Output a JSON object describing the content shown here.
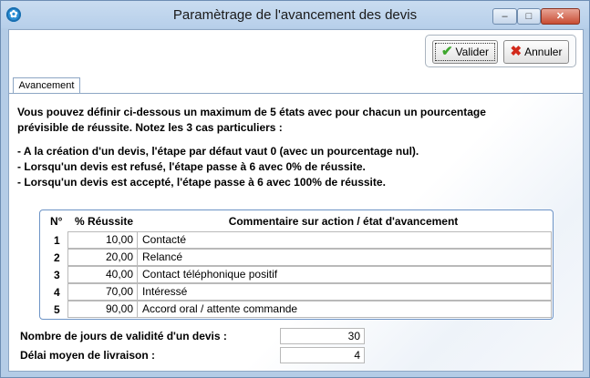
{
  "window": {
    "title": "Paramètrage de l'avancement des devis",
    "controls": {
      "minimize": "–",
      "maximize": "□",
      "close": "✕"
    }
  },
  "toolbar": {
    "validate_label": "Valider",
    "cancel_label": "Annuler"
  },
  "tabs": [
    {
      "label": "Avancement",
      "active": true
    }
  ],
  "intro": {
    "line1": "Vous pouvez définir ci-dessous un maximum de 5 états avec pour chacun un pourcentage",
    "line2": "prévisible de réussite. Notez les 3 cas particuliers :",
    "case1": "- A la création d'un devis, l'étape par défaut vaut 0 (avec un pourcentage nul).",
    "case2": "- Lorsqu'un devis est refusé, l'étape passe à 6 avec 0% de réussite.",
    "case3": "- Lorsqu'un devis est accepté, l'étape passe à 6 avec 100% de réussite."
  },
  "table": {
    "headers": {
      "num": "N°",
      "pct": "% Réussite",
      "comment": "Commentaire sur action / état d'avancement"
    },
    "rows": [
      {
        "num": "1",
        "pct": "10,00",
        "comment": "Contacté"
      },
      {
        "num": "2",
        "pct": "20,00",
        "comment": "Relancé"
      },
      {
        "num": "3",
        "pct": "40,00",
        "comment": "Contact téléphonique positif"
      },
      {
        "num": "4",
        "pct": "70,00",
        "comment": "Intéressé"
      },
      {
        "num": "5",
        "pct": "90,00",
        "comment": "Accord oral / attente commande"
      }
    ]
  },
  "fields": {
    "validity_label": "Nombre de jours de validité d'un devis :",
    "validity_value": "30",
    "delivery_label": "Délai moyen de livraison :",
    "delivery_value": "4"
  },
  "icons": {
    "app": "app-logo-icon",
    "validate": "check-icon",
    "cancel": "cross-icon"
  },
  "colors": {
    "frame": "#b4cce6",
    "grid_border": "#6c93c6",
    "check": "#3fa72e",
    "cross": "#d22a1c"
  }
}
